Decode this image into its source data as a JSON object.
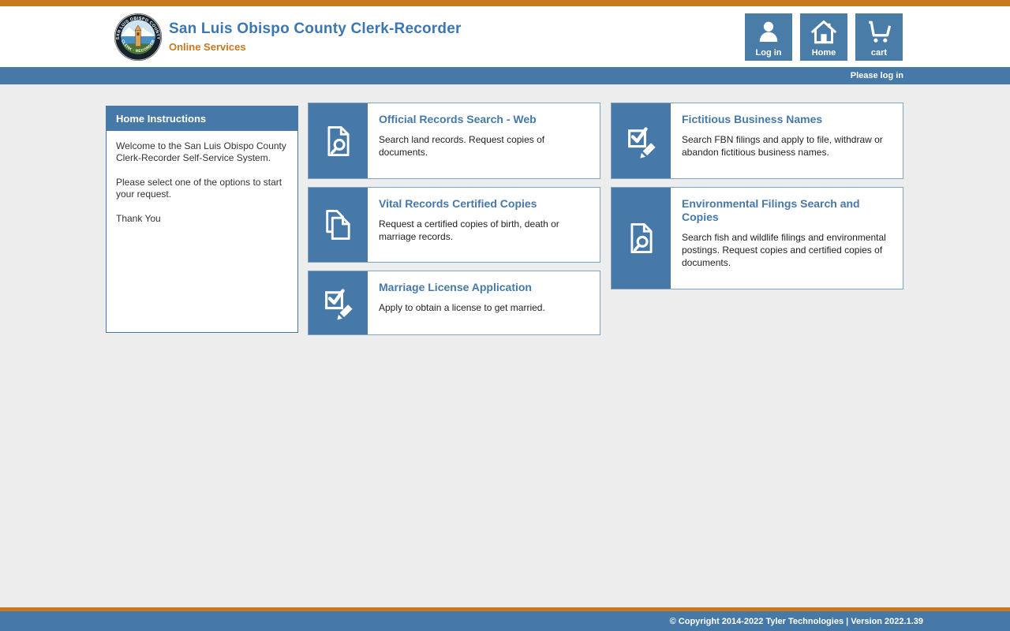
{
  "header": {
    "title": "San Luis Obispo County Clerk-Recorder",
    "subtitle": "Online Services",
    "buttons": [
      {
        "label": "Log in",
        "icon": "person-icon"
      },
      {
        "label": "Home",
        "icon": "home-icon"
      },
      {
        "label": "cart",
        "icon": "cart-icon"
      }
    ]
  },
  "status_bar": {
    "text": "Please log in"
  },
  "instructions": {
    "title": "Home Instructions",
    "paragraphs": [
      "Welcome to the San Luis Obispo County Clerk-Recorder Self-Service System.",
      "Please select one of the options to start your request.",
      "Thank You"
    ]
  },
  "services": [
    {
      "title": "Official Records Search - Web",
      "description": "Search land records. Request copies of documents.",
      "icon": "document-search-icon"
    },
    {
      "title": "Vital Records Certified Copies",
      "description": "Request a certified copies of birth, death or marriage records.",
      "icon": "document-copies-icon"
    },
    {
      "title": "Marriage License Application",
      "description": "Apply to obtain a license to get married.",
      "icon": "checkbox-pencil-icon"
    },
    {
      "title": "Fictitious Business Names",
      "description": "Search FBN filings and apply to file, withdraw or abandon fictitious business names.",
      "icon": "checkbox-pencil-icon"
    },
    {
      "title": "Environmental Filings Search and Copies",
      "description": "Search fish and wildlife filings and environmental postings. Request copies and certified copies of documents.",
      "icon": "document-search-icon"
    }
  ],
  "logo": {
    "ring_text_top": "SAN LUIS OBISPO COUNTY",
    "ring_text_bottom": "CLERK · RECORDER"
  },
  "footer": {
    "text": "© Copyright 2014-2022 Tyler Technologies | Version 2022.1.39"
  },
  "colors": {
    "accent_orange": "#C8791E",
    "accent_blue": "#4679A8",
    "title_blue": "#3A77B4",
    "background_gray": "#EDEDEE"
  }
}
